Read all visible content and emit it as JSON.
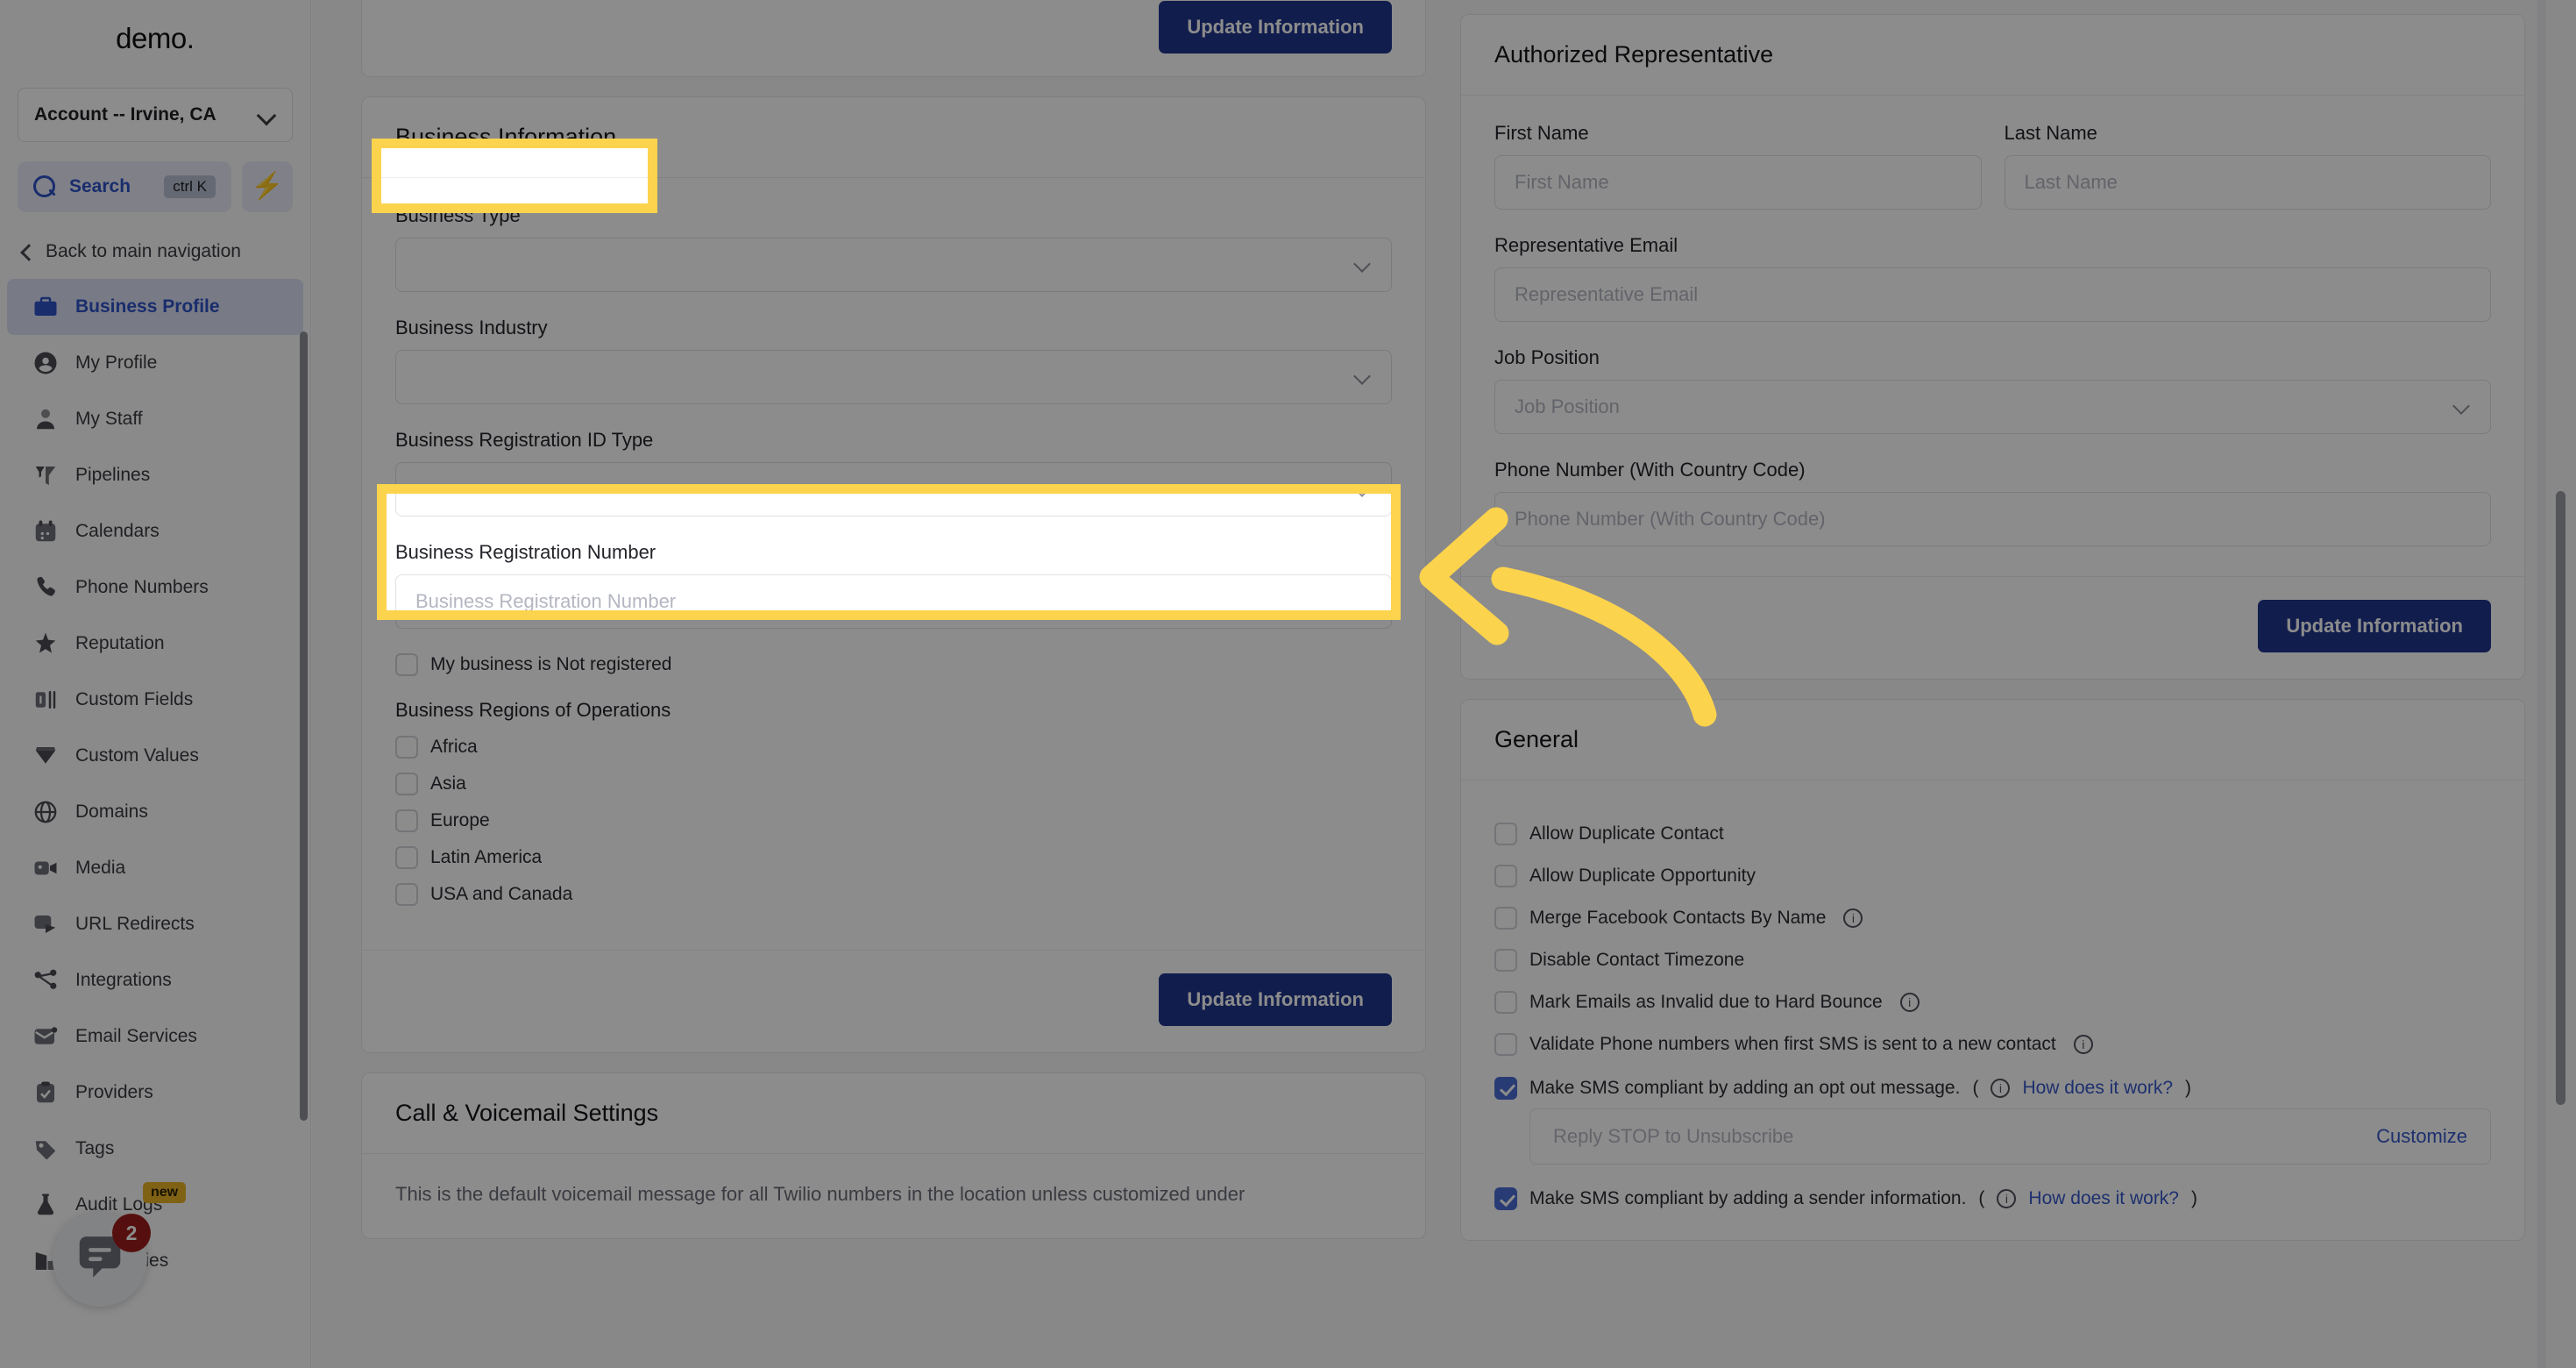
{
  "sidebar": {
    "logo": "demo",
    "account_selector": {
      "label": "Account -- Irvine, CA",
      "icon": "chevron-down-icon"
    },
    "search": {
      "label": "Search",
      "shortcut": "ctrl K",
      "icon": "search-icon"
    },
    "quick_action_icon": "lightning-bolt-icon",
    "back_nav": {
      "label": "Back to main navigation",
      "icon": "chevron-left-icon"
    },
    "items": [
      {
        "label": "Business Profile",
        "icon": "briefcase-icon",
        "active": true
      },
      {
        "label": "My Profile",
        "icon": "user-circle-icon",
        "active": false
      },
      {
        "label": "My Staff",
        "icon": "user-icon",
        "active": false
      },
      {
        "label": "Pipelines",
        "icon": "funnel-icon",
        "active": false
      },
      {
        "label": "Calendars",
        "icon": "calendar-icon",
        "active": false
      },
      {
        "label": "Phone Numbers",
        "icon": "phone-icon",
        "active": false
      },
      {
        "label": "Reputation",
        "icon": "star-icon",
        "active": false
      },
      {
        "label": "Custom Fields",
        "icon": "custom-field-icon",
        "active": false
      },
      {
        "label": "Custom Values",
        "icon": "diamond-icon",
        "active": false
      },
      {
        "label": "Domains",
        "icon": "globe-icon",
        "active": false
      },
      {
        "label": "Media",
        "icon": "video-camera-icon",
        "active": false
      },
      {
        "label": "URL Redirects",
        "icon": "redirect-icon",
        "active": false
      },
      {
        "label": "Integrations",
        "icon": "share-nodes-icon",
        "active": false
      },
      {
        "label": "Email Services",
        "icon": "envelope-icon",
        "active": false
      },
      {
        "label": "Providers",
        "icon": "clipboard-check-icon",
        "active": false
      },
      {
        "label": "Tags",
        "icon": "tag-icon",
        "active": false
      },
      {
        "label": "Audit Logs",
        "icon": "beaker-icon",
        "active": false,
        "badge": "new"
      },
      {
        "label": "Companies",
        "icon": "building-icon",
        "active": false
      }
    ],
    "chat_widget": {
      "icon": "chat-bubble-icon",
      "unread_count": "2"
    }
  },
  "top_button": {
    "label": "Update Information"
  },
  "business_information": {
    "title": "Business Information",
    "fields": [
      {
        "label": "Business Type",
        "value": "",
        "placeholder": "",
        "control": "select"
      },
      {
        "label": "Business Industry",
        "value": "",
        "placeholder": "",
        "control": "select"
      },
      {
        "label": "Business Registration ID Type",
        "value": "",
        "placeholder": "",
        "control": "select"
      },
      {
        "label": "Business Registration Number",
        "value": "",
        "placeholder": "Business Registration Number",
        "control": "text"
      }
    ],
    "not_registered_checkbox": {
      "label": "My business is Not registered",
      "checked": false
    },
    "regions_label": "Business Regions of Operations",
    "regions": [
      {
        "label": "Africa",
        "checked": false
      },
      {
        "label": "Asia",
        "checked": false
      },
      {
        "label": "Europe",
        "checked": false
      },
      {
        "label": "Latin America",
        "checked": false
      },
      {
        "label": "USA and Canada",
        "checked": false
      }
    ],
    "submit_label": "Update Information"
  },
  "call_voicemail": {
    "title": "Call & Voicemail Settings",
    "note": "This is the default voicemail message for all Twilio numbers in the location unless customized under"
  },
  "authorized_representative": {
    "title": "Authorized Representative",
    "first_name": {
      "label": "First Name",
      "placeholder": "First Name",
      "value": ""
    },
    "last_name": {
      "label": "Last Name",
      "placeholder": "Last Name",
      "value": ""
    },
    "email": {
      "label": "Representative Email",
      "placeholder": "Representative Email",
      "value": ""
    },
    "job_position": {
      "label": "Job Position",
      "placeholder": "Job Position",
      "value": ""
    },
    "phone": {
      "label": "Phone Number (With Country Code)",
      "placeholder": "Phone Number (With Country Code)",
      "value": ""
    },
    "submit_label": "Update Information"
  },
  "general": {
    "title": "General",
    "options": [
      {
        "label": "Allow Duplicate Contact",
        "checked": false,
        "info": false
      },
      {
        "label": "Allow Duplicate Opportunity",
        "checked": false,
        "info": false
      },
      {
        "label": "Merge Facebook Contacts By Name",
        "checked": false,
        "info": true
      },
      {
        "label": "Disable Contact Timezone",
        "checked": false,
        "info": false
      },
      {
        "label": "Mark Emails as Invalid due to Hard Bounce",
        "checked": false,
        "info": true
      },
      {
        "label": "Validate Phone numbers when first SMS is sent to a new contact",
        "checked": false,
        "info": true
      }
    ],
    "sms_optout": {
      "label": "Make SMS compliant by adding an opt out message.",
      "checked": true,
      "info": true,
      "link": "How does it work?",
      "paren_open": "(",
      "paren_close": ")",
      "input_placeholder": "Reply STOP to Unsubscribe",
      "customize_label": "Customize"
    },
    "sms_sender": {
      "label": "Make SMS compliant by adding a sender information.",
      "checked": true,
      "info": true,
      "link": "How does it work?",
      "paren_open": "(",
      "paren_close": ")"
    }
  },
  "annotations": {
    "highlight_1": "Business Information",
    "highlight_2": "Business Registration ID Type",
    "arrow_color": "#fcd34d",
    "highlight_color": "#fcd34d"
  }
}
